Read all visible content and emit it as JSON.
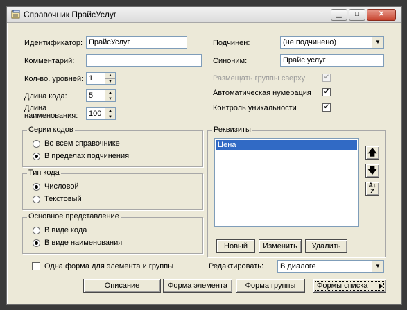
{
  "window": {
    "title": "Справочник ПрайсУслуг"
  },
  "fields": {
    "identifier_label": "Идентификатор:",
    "identifier_value": "ПрайсУслуг",
    "comment_label": "Комментарий:",
    "comment_value": "",
    "levels_label": "Кол-во. уровней:",
    "levels_value": "1",
    "code_len_label": "Длина кода:",
    "code_len_value": "5",
    "name_len_label": "Длина наименования:",
    "name_len_value": "100",
    "subordinate_label": "Подчинен:",
    "subordinate_value": "(не подчинено)",
    "synonym_label": "Синоним:",
    "synonym_value": "Прайс услуг"
  },
  "options": {
    "groups_top": "Размещать группы сверху",
    "groups_top_checked": true,
    "auto_number": "Автоматическая нумерация",
    "auto_number_checked": true,
    "uniqueness": "Контроль уникальности",
    "uniqueness_checked": true
  },
  "code_series": {
    "title": "Серии кодов",
    "opt1": "Во всем справочнике",
    "opt2": "В пределах подчинения",
    "selected": 2
  },
  "code_type": {
    "title": "Тип кода",
    "opt1": "Числовой",
    "opt2": "Текстовый",
    "selected": 1
  },
  "main_view": {
    "title": "Основное представление",
    "opt1": "В виде кода",
    "opt2": "В виде наименования",
    "selected": 2
  },
  "requisites": {
    "title": "Реквизиты",
    "items": [
      "Цена"
    ],
    "new_label": "Новый",
    "edit_label": "Изменить",
    "delete_label": "Удалить"
  },
  "bottom": {
    "one_form_label": "Одна форма для элемента и группы",
    "one_form_checked": false,
    "edit_label": "Редактировать:",
    "edit_value": "В диалоге",
    "description_btn": "Описание",
    "element_form_btn": "Форма элемента",
    "group_form_btn": "Форма группы",
    "list_forms_btn": "Формы списка"
  }
}
